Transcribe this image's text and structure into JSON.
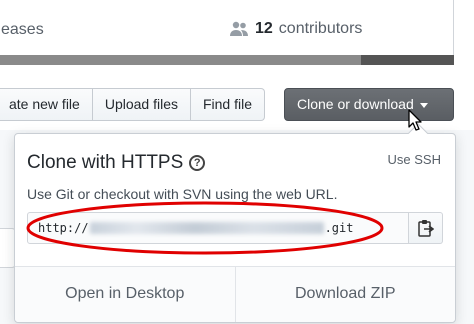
{
  "summary": {
    "releases_label": "eases",
    "contributors_count": "12",
    "contributors_label": "contributors"
  },
  "toolbar": {
    "create_new_file": "ate new file",
    "upload_files": "Upload files",
    "find_file": "Find file",
    "clone_or_download": "Clone or download"
  },
  "clone_popover": {
    "title": "Clone with HTTPS",
    "help_icon": "question-circle-icon",
    "use_ssh": "Use SSH",
    "description": "Use Git or checkout with SVN using the web URL.",
    "url_prefix": "http://",
    "url_suffix": ".git",
    "copy_icon": "clipboard-icon",
    "open_in_desktop": "Open in Desktop",
    "download_zip": "Download ZIP"
  },
  "colors": {
    "clone_button_bg": "#5f6368",
    "annotation_ellipse": "#e00000",
    "language_bar_light": "#8a8a8a",
    "language_bar_dark": "#555555"
  }
}
